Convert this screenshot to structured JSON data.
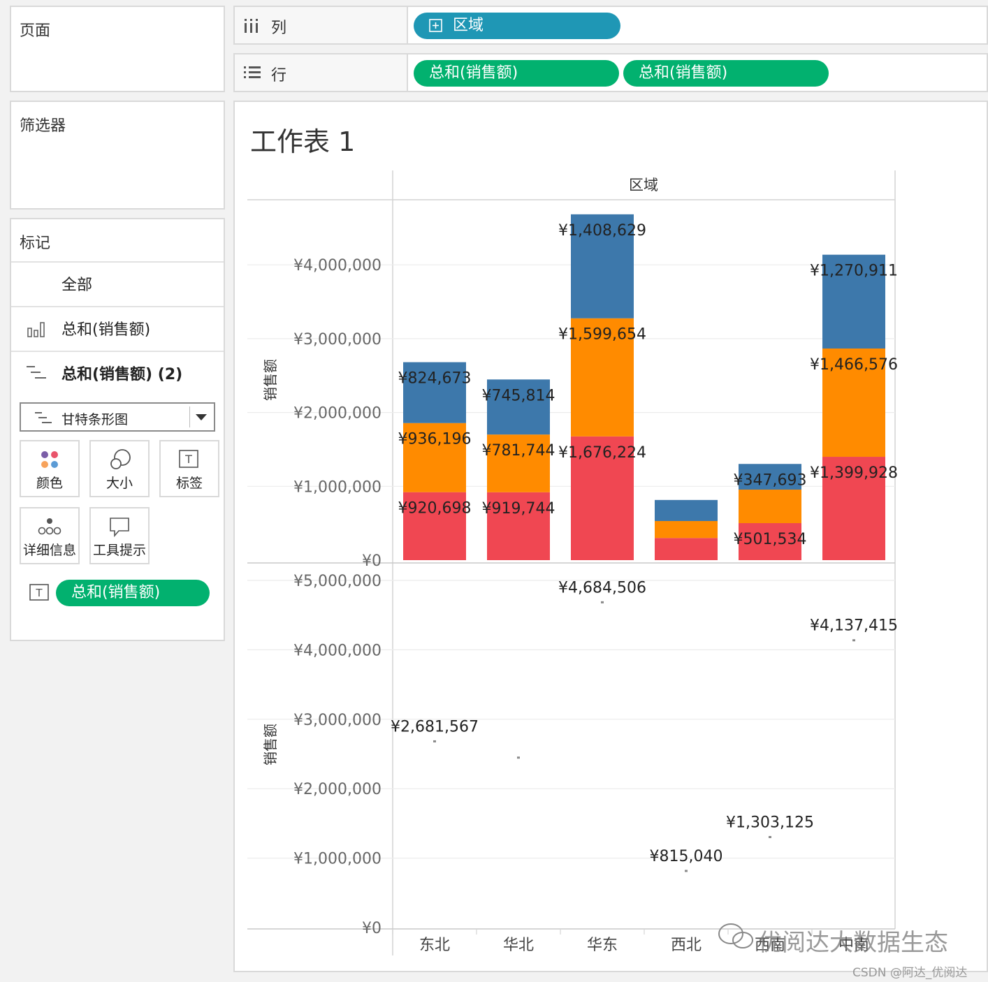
{
  "pages_panel": {
    "title": "页面"
  },
  "filters_panel": {
    "title": "筛选器"
  },
  "marks_panel": {
    "title": "标记",
    "rows": [
      "全部",
      "总和(销售额)",
      "总和(销售额) (2)"
    ],
    "mark_type": "甘特条形图",
    "cards": [
      "颜色",
      "大小",
      "标签",
      "详细信息",
      "工具提示"
    ],
    "label_pill": "总和(销售额)"
  },
  "columns_shelf": {
    "label": "列",
    "pills": [
      "区域"
    ]
  },
  "rows_shelf": {
    "label": "行",
    "pills": [
      "总和(销售额)",
      "总和(销售额)"
    ]
  },
  "sheet": {
    "title": "工作表 1",
    "header": "区域"
  },
  "colors": {
    "red": "#f04752",
    "orange": "#ff8b00",
    "blue": "#3d78ab",
    "pill_blue": "#1f97b5",
    "pill_green": "#02b16f"
  },
  "chart_data": [
    {
      "type": "bar",
      "stacked": true,
      "categories": [
        "东北",
        "华北",
        "华东",
        "西北",
        "西南",
        "中南"
      ],
      "ylabel": "销售额",
      "ylim": [
        0,
        4700000
      ],
      "yticks": [
        0,
        1000000,
        2000000,
        3000000,
        4000000
      ],
      "ytick_labels": [
        "¥0",
        "¥1,000,000",
        "¥2,000,000",
        "¥3,000,000",
        "¥4,000,000"
      ],
      "series": [
        {
          "color": "#f04752",
          "values": [
            920698,
            919744,
            1676224,
            300000,
            501534,
            1399928
          ],
          "labels": [
            "¥920,698",
            "¥919,744",
            "¥1,676,224",
            "",
            "¥501,534",
            "¥1,399,928"
          ]
        },
        {
          "color": "#ff8b00",
          "values": [
            936196,
            781744,
            1599654,
            230000,
            453898,
            1466576
          ],
          "labels": [
            "¥936,196",
            "¥781,744",
            "¥1,599,654",
            "",
            "",
            "¥1,466,576"
          ]
        },
        {
          "color": "#3d78ab",
          "values": [
            824673,
            745814,
            1408629,
            285040,
            347693,
            1270911
          ],
          "labels": [
            "¥824,673",
            "¥745,814",
            "¥1,408,629",
            "",
            "¥347,693",
            "¥1,270,911"
          ]
        }
      ]
    },
    {
      "type": "scatter",
      "categories": [
        "东北",
        "华北",
        "华东",
        "西北",
        "西南",
        "中南"
      ],
      "ylabel": "销售额",
      "ylim": [
        0,
        5000000
      ],
      "yticks": [
        0,
        1000000,
        2000000,
        3000000,
        4000000,
        5000000
      ],
      "ytick_labels": [
        "¥0",
        "¥1,000,000",
        "¥2,000,000",
        "¥3,000,000",
        "¥4,000,000",
        "¥5,000,000"
      ],
      "values": [
        2681567,
        2447302,
        4684506,
        815040,
        1303125,
        4137415
      ],
      "labels": [
        "¥2,681,567",
        "",
        "¥4,684,506",
        "¥815,040",
        "¥1,303,125",
        "¥4,137,415"
      ]
    }
  ],
  "x_axis_labels": [
    "东北",
    "华北",
    "华东",
    "西北",
    "西南",
    "中南"
  ],
  "watermark": "优阅达大数据生态",
  "credit": "CSDN @阿达_优阅达"
}
